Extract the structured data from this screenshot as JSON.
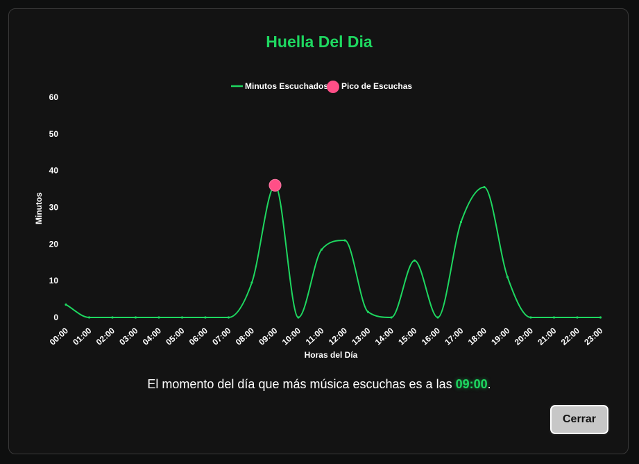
{
  "modal": {
    "title": "Huella Del Dia",
    "summary_prefix": "El momento del día que más música escuchas es a las ",
    "summary_time": "09:00",
    "summary_suffix": ".",
    "close_label": "Cerrar"
  },
  "colors": {
    "accent": "#1ed760",
    "peak": "#ff4f87",
    "background": "#131313"
  },
  "chart_data": {
    "type": "line",
    "title": "",
    "xlabel": "Horas del Día",
    "ylabel": "Minutos",
    "ylim": [
      0,
      60
    ],
    "yticks": [
      0,
      10,
      20,
      30,
      40,
      50,
      60
    ],
    "grid": false,
    "legend_position": "top-center",
    "categories": [
      "00:00",
      "01:00",
      "02:00",
      "03:00",
      "04:00",
      "05:00",
      "06:00",
      "07:00",
      "08:00",
      "09:00",
      "10:00",
      "11:00",
      "12:00",
      "13:00",
      "14:00",
      "15:00",
      "16:00",
      "17:00",
      "18:00",
      "19:00",
      "20:00",
      "21:00",
      "22:00",
      "23:00"
    ],
    "series": [
      {
        "name": "Minutos Escuchados",
        "color": "#1ed760",
        "values": [
          3.5,
          0,
          0,
          0,
          0,
          0,
          0,
          0,
          9.5,
          36,
          0,
          18.5,
          21,
          1.5,
          0,
          15.5,
          0,
          26,
          35.5,
          11,
          0,
          0,
          0,
          0
        ]
      },
      {
        "name": "Pico de Escuchas",
        "color": "#ff4f87",
        "type": "point",
        "points": [
          {
            "x": "09:00",
            "y": 36
          }
        ]
      }
    ]
  }
}
